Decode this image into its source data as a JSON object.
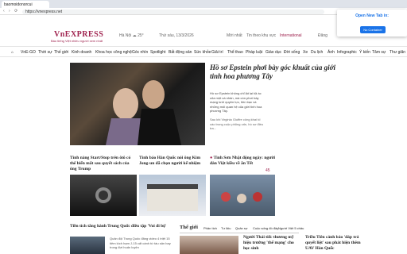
{
  "browser": {
    "tab_label": "baomoidonorcui",
    "url": "https://vnexpress.net"
  },
  "popup": {
    "title": "Open New Tab in:",
    "button": "No Container"
  },
  "header": {
    "logo": "VnEXPRESS",
    "tagline": "Báo tiếng Việt nhiều người xem nhất",
    "location": "Hà Nội",
    "temp": "25°",
    "date": "Thứ sáu, 13/3/2026",
    "latest": "Mới nhất",
    "search": "Tin theo khu vực",
    "international": "International",
    "login": "Đăng"
  },
  "nav": [
    "Thời sự",
    "Thế giới",
    "Kinh doanh",
    "Khoa học công nghệ",
    "Góc nhìn",
    "Spotlight",
    "Bất động sản",
    "Sức khỏe",
    "Giải trí",
    "Thể thao",
    "Pháp luật",
    "Giáo dục",
    "Đời sống",
    "Xe",
    "Du lịch",
    "Ảnh",
    "Infographic",
    "Ý kiến",
    "Tâm sự",
    "Thư giãn"
  ],
  "nav_first": "VnE-GO",
  "hero": {
    "title": "Hồ sơ Epstein phơi bày góc khuất của giới tinh hoa phương Tây",
    "desc": "Hồ sơ Epstein không chỉ lật lại tội ác của một cá nhân, mà còn phơi bày mạng lưới quyền lực, tiền bạc và những mối quan hệ của giới tinh hoa phương Tây.",
    "related": "Sau khi Virginia Giuffre công khai tố cáo trong cuộc phỏng vấn, hồ sơ điều tra..."
  },
  "cards": [
    {
      "title": "Tình nàng Start/Stop trên ôtô có thể biến mất sau quyết sách của ông Trump"
    },
    {
      "title": "Tình báo Hàn Quốc nói ông Kim Jong-un đã chọn người kế nhiệm"
    },
    {
      "title": "Tình Sơn Nhật động ngày: người đàn Việt kiều về ăn Tết",
      "badge": "45"
    }
  ],
  "bottom_left": {
    "title": "Tiền tích tăng hành Trung Quốc điều tập 'Voi đi bộ'",
    "small": "Quân đội Trung Quốc đăng video 4 triệt 15 tiêm kích hạm J-15 cất cánh từ tàu sân bay trong đợt huấn luyện"
  },
  "section": {
    "name": "Thế giới",
    "tabs": [
      "Phân tích",
      "Tư liệu",
      "Quân sự",
      "Cuộc sống đó đây",
      "Người Việt 5 châu",
      "Bầu Mỹ"
    ]
  },
  "bottom_mid": {
    "title": "Người Thái tiếc thương mỹ hiệu trưởng 'thế mạng' cho học sinh"
  },
  "bottom_right": {
    "title": "Triều Tiên cảnh báo 'đáp trả quyết liệt' sau phát hiện thêm UAV Hàn Quốc"
  }
}
